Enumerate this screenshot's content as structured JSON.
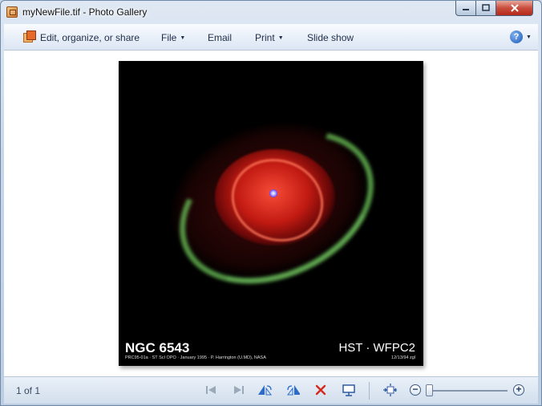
{
  "window": {
    "title": "myNewFile.tif - Photo Gallery"
  },
  "toolbar": {
    "edit_label": "Edit, organize, or share",
    "file_label": "File",
    "email_label": "Email",
    "print_label": "Print",
    "slideshow_label": "Slide show",
    "help_glyph": "?"
  },
  "photo": {
    "object_name": "NGC 6543",
    "credit": "PRC95-01a · ST ScI OPO · January 1995 · P. Harrington (U.MD), NASA",
    "instrument": "HST · WFPC2",
    "date_code": "12/13/94 zgl"
  },
  "status": {
    "position_text": "1 of 1"
  },
  "icons": {
    "app": "photo-gallery-icon",
    "previous": "previous-icon",
    "next": "next-icon",
    "rotate_left": "rotate-counterclockwise-icon",
    "rotate_right": "rotate-clockwise-icon",
    "delete": "delete-icon",
    "slideshow": "slideshow-icon",
    "fit": "actual-size-icon",
    "zoom_out": "zoom-out-icon",
    "zoom_in": "zoom-in-icon"
  },
  "colors": {
    "accent": "#1e5bb8",
    "delete_red": "#d42a1e",
    "close_button": "#c94d3c"
  }
}
